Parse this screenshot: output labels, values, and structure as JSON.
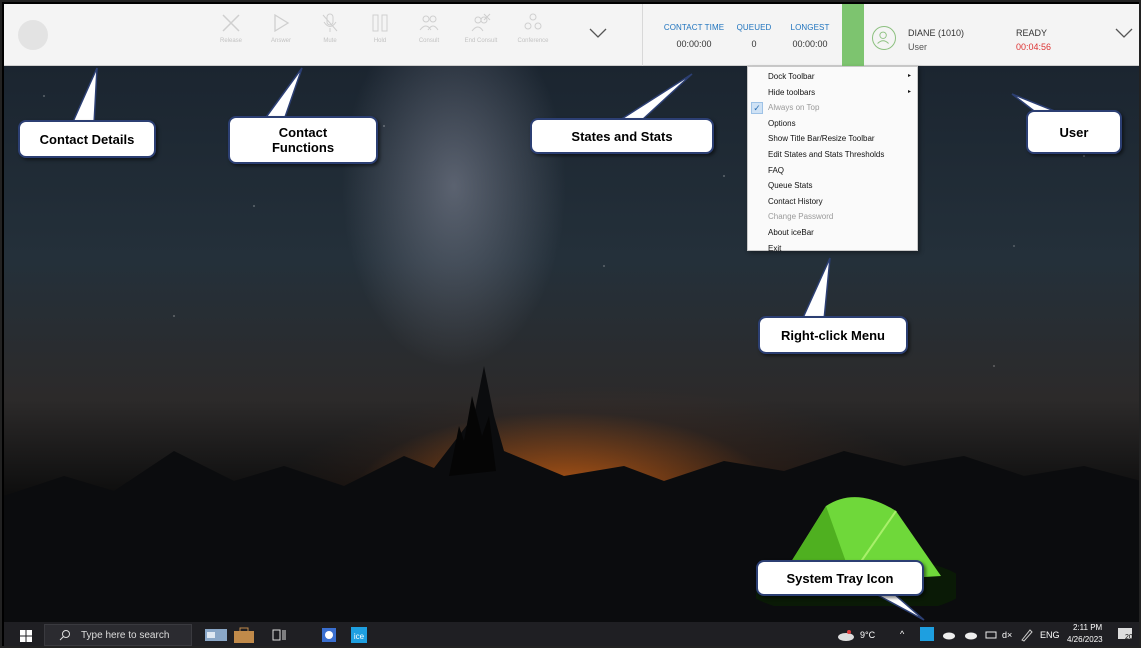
{
  "toolbar": {
    "functions": [
      {
        "label": "Release",
        "icon": "x-icon"
      },
      {
        "label": "Answer",
        "icon": "play-icon"
      },
      {
        "label": "Mute",
        "icon": "mic-off-icon"
      },
      {
        "label": "Hold",
        "icon": "pause-icon"
      },
      {
        "label": "Consult",
        "icon": "users-icon"
      },
      {
        "label": "End Consult",
        "icon": "users-x-icon"
      },
      {
        "label": "Conference",
        "icon": "conference-icon"
      }
    ],
    "stats": [
      {
        "header": "CONTACT TIME",
        "value": "00:00:00"
      },
      {
        "header": "QUEUED",
        "value": "0"
      },
      {
        "header": "LONGEST",
        "value": "00:00:00"
      }
    ],
    "user": {
      "name": "DIANE (1010)",
      "role": "User",
      "state": "READY",
      "timer": "00:04:56"
    },
    "colors": {
      "stat_header": "#1e73be",
      "ready_bar": "#7dc46f",
      "timer": "#dd3333"
    }
  },
  "menu": {
    "items": [
      {
        "label": "Dock Toolbar",
        "submenu": true,
        "disabled": false,
        "checked": false
      },
      {
        "label": "Hide toolbars",
        "submenu": true,
        "disabled": false,
        "checked": false
      },
      {
        "label": "Always on Top",
        "submenu": false,
        "disabled": true,
        "checked": true
      },
      {
        "label": "Options",
        "submenu": false,
        "disabled": false,
        "checked": false
      },
      {
        "label": "Show Title Bar/Resize Toolbar",
        "submenu": false,
        "disabled": false,
        "checked": false
      },
      {
        "label": "Edit States and Stats Thresholds",
        "submenu": false,
        "disabled": false,
        "checked": false
      },
      {
        "label": "FAQ",
        "submenu": false,
        "disabled": false,
        "checked": false
      },
      {
        "label": "Queue Stats",
        "submenu": false,
        "disabled": false,
        "checked": false
      },
      {
        "label": "Contact History",
        "submenu": false,
        "disabled": false,
        "checked": false
      },
      {
        "label": "Change Password",
        "submenu": false,
        "disabled": true,
        "checked": false
      },
      {
        "label": "About iceBar",
        "submenu": false,
        "disabled": false,
        "checked": false
      },
      {
        "label": "Exit",
        "submenu": false,
        "disabled": false,
        "checked": false
      }
    ],
    "submenu_glyph": "▸",
    "check_glyph": "✓"
  },
  "callouts": {
    "contact_details": "Contact Details",
    "contact_functions": "Contact\nFunctions",
    "states_stats": "States and Stats",
    "user": "User",
    "right_click_menu": "Right-click Menu",
    "system_tray": "System Tray Icon"
  },
  "taskbar": {
    "search_placeholder": "Type here to search",
    "weather": "9°C",
    "language": "ENG",
    "time": "2:11 PM",
    "date": "4/26/2023",
    "notification_count": "20",
    "tray_glyphs": {
      "expand": "^",
      "volume": "d×"
    }
  }
}
